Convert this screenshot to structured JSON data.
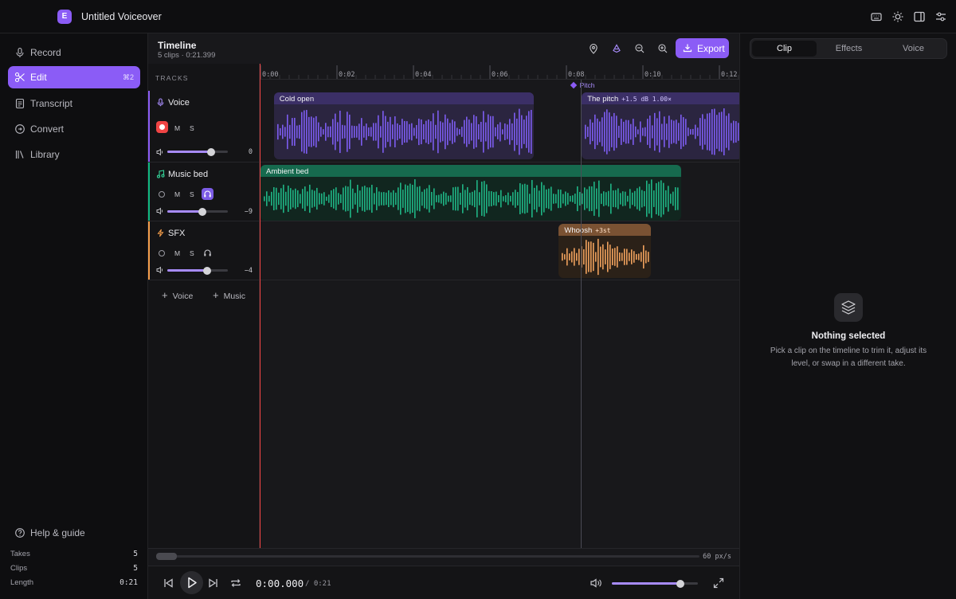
{
  "app": {
    "title": "Untitled Voiceover",
    "logo": "E"
  },
  "sidebar": {
    "items": [
      {
        "label": "Record",
        "icon": "mic-icon"
      },
      {
        "label": "Edit",
        "icon": "scissors-icon",
        "shortcut": "⌘2",
        "active": true
      },
      {
        "label": "Transcript",
        "icon": "document-icon"
      },
      {
        "label": "Convert",
        "icon": "convert-icon"
      },
      {
        "label": "Library",
        "icon": "library-icon"
      }
    ],
    "help": "Help & guide",
    "stats": [
      {
        "label": "Takes",
        "value": "5"
      },
      {
        "label": "Clips",
        "value": "5"
      },
      {
        "label": "Length",
        "value": "0:21"
      }
    ]
  },
  "timeline": {
    "title": "Timeline",
    "subtitle": "5 clips · 0:21.399",
    "export_label": "Export",
    "tracks_label": "TRACKS",
    "tracks": [
      {
        "name": "Voice",
        "color": "#8b5cf6",
        "mute": "M",
        "solo": "S",
        "volume": 0.72,
        "volume_label": "0"
      },
      {
        "name": "Music bed",
        "color": "#10b981",
        "mute": "M",
        "solo": "S",
        "volume": 0.58,
        "volume_label": "−9"
      },
      {
        "name": "SFX",
        "color": "#f59e4b",
        "mute": "M",
        "solo": "S",
        "volume": 0.66,
        "volume_label": "−4"
      }
    ],
    "add_voice": "Voice",
    "add_music": "Music",
    "ruler_ticks": [
      "0:00",
      "0:02",
      "0:04",
      "0:06",
      "0:08",
      "0:10",
      "0:12"
    ],
    "marker": {
      "label": "Pitch",
      "time": 8.2
    },
    "clips": [
      {
        "track": 0,
        "label": "Cold open",
        "tag": "",
        "start": 0.35,
        "end": 7.15
      },
      {
        "track": 0,
        "label": "The pitch",
        "tag": "+1.5 dB 1.00×",
        "start": 8.4,
        "end": 12.6
      },
      {
        "track": 1,
        "label": "Ambient bed",
        "tag": "",
        "start": 0.0,
        "end": 11.0
      },
      {
        "track": 2,
        "label": "Whoosh",
        "tag": "+3st",
        "start": 7.8,
        "end": 10.2
      }
    ],
    "zoom_label": "60 px/s",
    "time_current": "0:00.000",
    "time_total": "/ 0:21",
    "master_volume": 0.8
  },
  "panel": {
    "tabs": [
      "Clip",
      "Effects",
      "Voice"
    ],
    "active_tab": 0,
    "empty_title": "Nothing selected",
    "empty_desc": "Pick a clip on the timeline to trim it, adjust its level, or swap in a different take."
  }
}
